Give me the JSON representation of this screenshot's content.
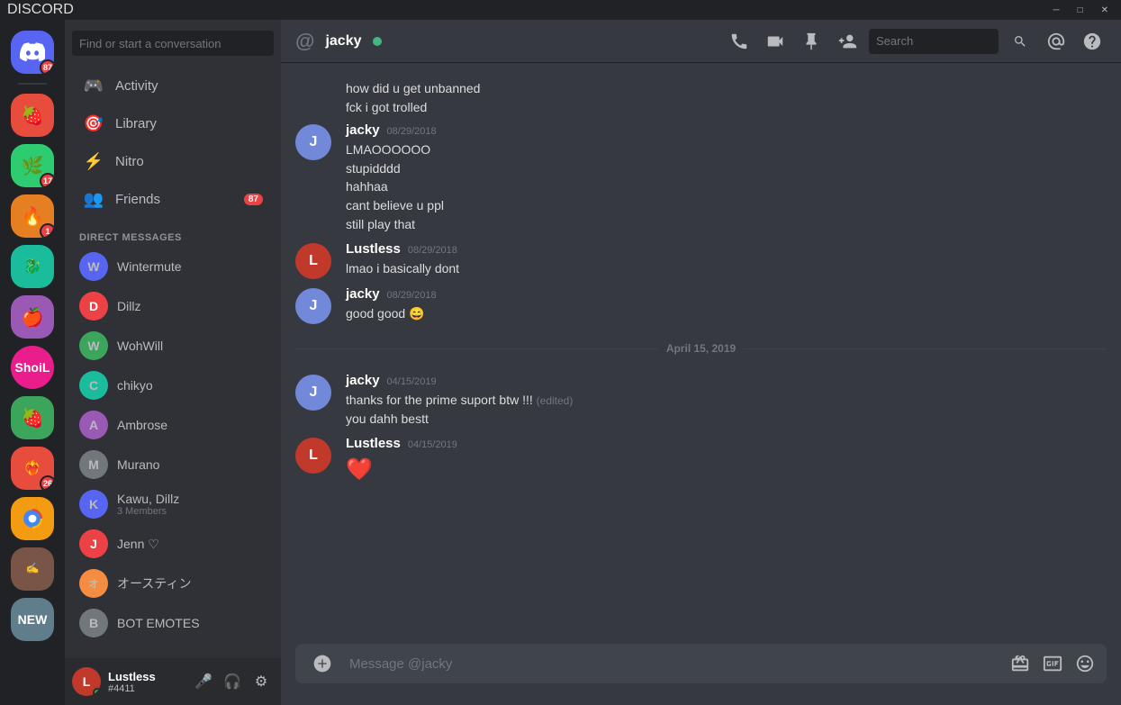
{
  "titlebar": {
    "title": "DISCORD",
    "minimize": "─",
    "maximize": "□",
    "close": "✕"
  },
  "sidebar": {
    "search_placeholder": "Find or start a conversation",
    "discord_badge": "87",
    "nav_items": [
      {
        "id": "activity",
        "label": "Activity",
        "icon": "🎮"
      },
      {
        "id": "library",
        "label": "Library",
        "icon": "🎯"
      },
      {
        "id": "nitro",
        "label": "Nitro",
        "icon": "⚡"
      },
      {
        "id": "friends",
        "label": "Friends",
        "icon": "👥",
        "badge": "87"
      }
    ],
    "dm_section_label": "DIRECT MESSAGES",
    "dm_list": [
      {
        "id": "wintermute",
        "name": "Wintermute",
        "color": "#5865f2",
        "initials": "W"
      },
      {
        "id": "dillz",
        "name": "Dillz",
        "color": "#ed4245",
        "initials": "D"
      },
      {
        "id": "wohwill",
        "name": "WohWill",
        "color": "#3ba55c",
        "initials": "W"
      },
      {
        "id": "chikyo",
        "name": "chikyo",
        "color": "#1abc9c",
        "initials": "C"
      },
      {
        "id": "ambrose",
        "name": "Ambrose",
        "color": "#9b59b6",
        "initials": "A"
      },
      {
        "id": "murano",
        "name": "Murano",
        "color": "#72767d",
        "initials": "M"
      },
      {
        "id": "kawu-dillz",
        "name": "Kawu, Dillz",
        "sub": "3 Members",
        "color": "#5865f2",
        "initials": "K",
        "is_group": true
      },
      {
        "id": "jenn",
        "name": "Jenn ♡",
        "color": "#ed4245",
        "initials": "J"
      },
      {
        "id": "austin",
        "name": "オースティン",
        "color": "#f48c42",
        "initials": "オ"
      },
      {
        "id": "bot-emotes",
        "name": "BOT EMOTES",
        "color": "#72767d",
        "initials": "B"
      }
    ]
  },
  "user_panel": {
    "name": "Lustless",
    "discriminator": "#4411",
    "avatar_color": "#c0392b",
    "new_badge": "NEW"
  },
  "chat_header": {
    "at_symbol": "@",
    "username": "jacky",
    "status": "online",
    "search_placeholder": "Search",
    "icons": {
      "call": "📞",
      "video": "📷",
      "pin": "📌",
      "add_friend": "👤",
      "at": "@",
      "help": "?"
    }
  },
  "messages": [
    {
      "id": "msg1",
      "type": "continuation",
      "lines": [
        "how did u get unbanned",
        "fck i got trolled"
      ]
    },
    {
      "id": "msg2",
      "type": "group",
      "author": "jacky",
      "timestamp": "08/29/2018",
      "avatar_color": "#7289da",
      "lines": [
        "LMAOOOOOO",
        "stupidddd",
        "hahhaa",
        "cant believe u ppl",
        "still play that"
      ]
    },
    {
      "id": "msg3",
      "type": "group",
      "author": "Lustless",
      "timestamp": "08/29/2018",
      "avatar_color": "#c0392b",
      "lines": [
        "lmao i basically dont"
      ]
    },
    {
      "id": "msg4",
      "type": "group",
      "author": "jacky",
      "timestamp": "08/29/2018",
      "avatar_color": "#7289da",
      "lines": [
        "good good 😄"
      ]
    },
    {
      "id": "divider1",
      "type": "divider",
      "text": "April 15, 2019"
    },
    {
      "id": "msg5",
      "type": "group",
      "author": "jacky",
      "timestamp": "04/15/2019",
      "avatar_color": "#7289da",
      "lines": [
        "thanks for the prime suport btw !!! (edited)",
        "you dahh bestt"
      ]
    },
    {
      "id": "msg6",
      "type": "group",
      "author": "Lustless",
      "timestamp": "04/15/2019",
      "avatar_color": "#c0392b",
      "lines": [
        "❤️"
      ]
    }
  ],
  "message_input": {
    "placeholder": "Message @jacky"
  }
}
